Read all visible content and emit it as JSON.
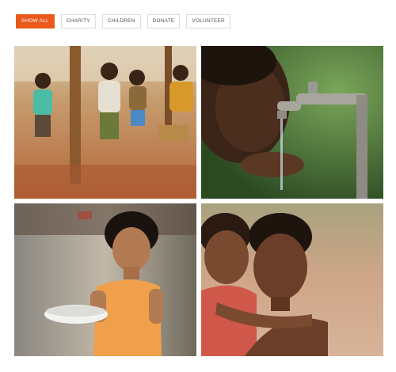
{
  "filters": {
    "items": [
      {
        "label": "SHOW ALL",
        "active": true
      },
      {
        "label": "CHARITY",
        "active": false
      },
      {
        "label": "CHILDREN",
        "active": false
      },
      {
        "label": "DONATE",
        "active": false
      },
      {
        "label": "VOLUNTEER",
        "active": false
      }
    ]
  },
  "gallery": {
    "photos": [
      {
        "subject": "group of children standing on dirt ground",
        "dominant_color": "#c98a5a"
      },
      {
        "subject": "child drinking water from a tap",
        "dominant_color": "#3f6a32"
      },
      {
        "subject": "girl in orange dress holding a bowl",
        "dominant_color": "#e79a52"
      },
      {
        "subject": "two children embracing",
        "dominant_color": "#b77a5c"
      }
    ]
  },
  "colors": {
    "accent": "#e8591a",
    "button_border": "#dcdcdc",
    "button_text": "#555555"
  }
}
